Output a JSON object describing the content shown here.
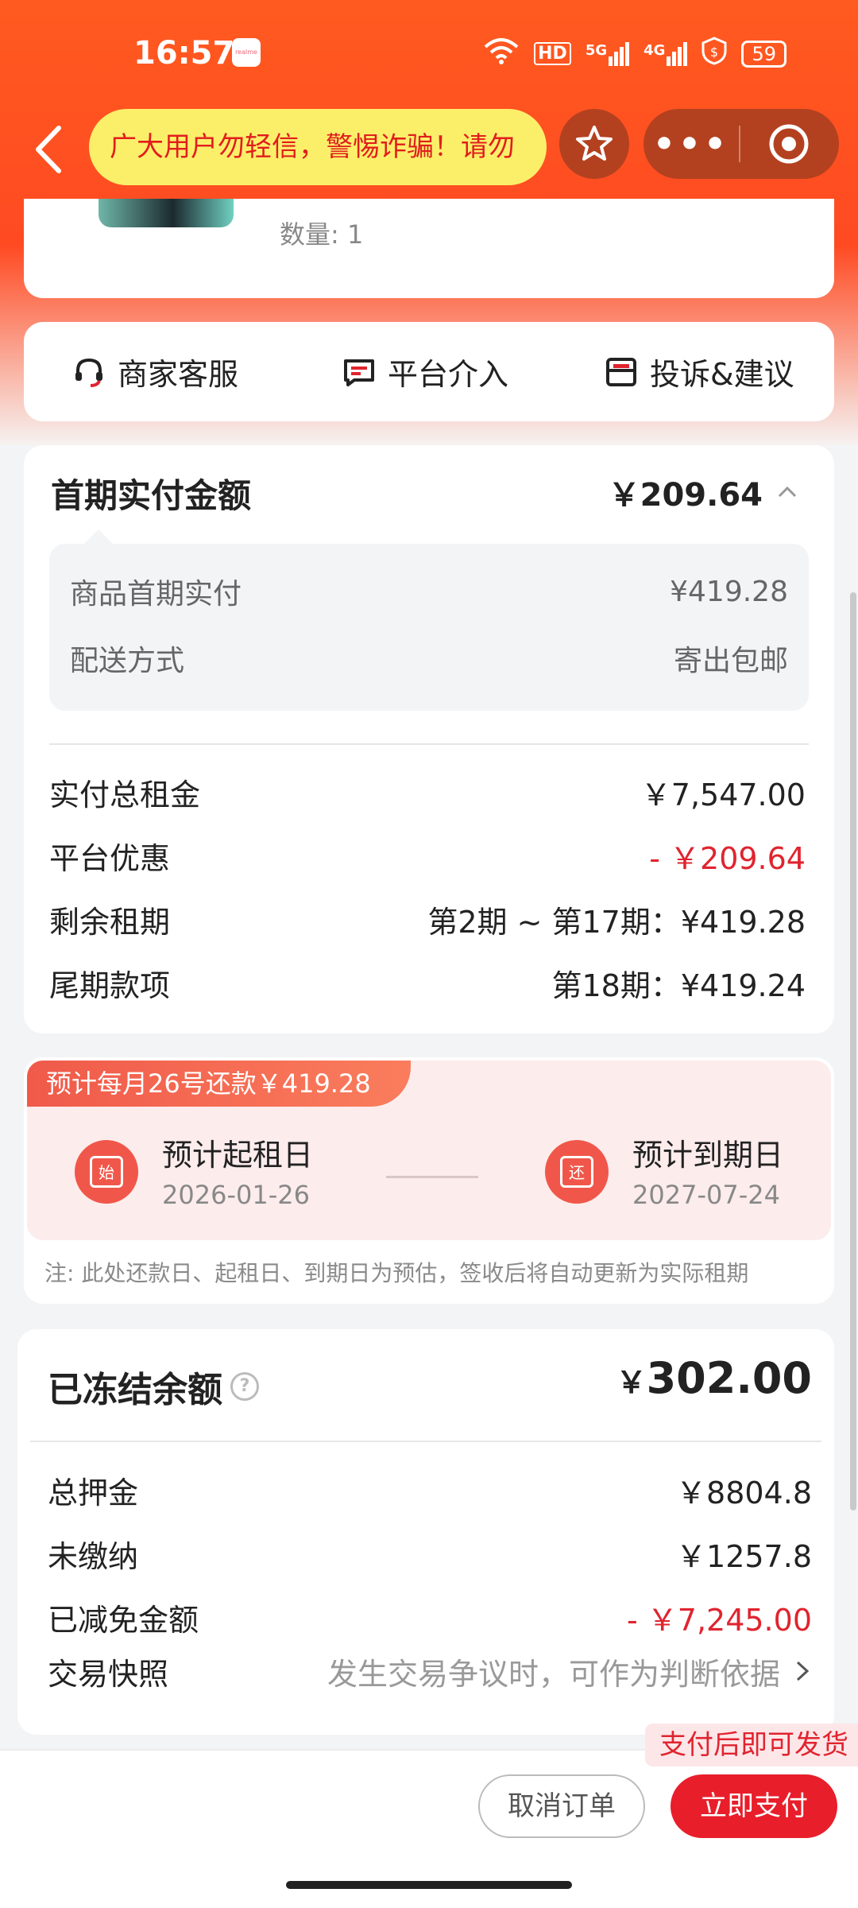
{
  "status_bar": {
    "time": "16:57",
    "app_icon_text": "realme",
    "network_hd": "HD",
    "network_5g": "5G",
    "network_4g": "4G",
    "battery": "59"
  },
  "nav": {
    "notice_text": "广大用户勿轻信，警惕诈骗！请勿",
    "more_label": "•••"
  },
  "product": {
    "quantity": "数量: 1"
  },
  "service": {
    "items": [
      {
        "label": "商家客服",
        "icon": "headset-icon"
      },
      {
        "label": "平台介入",
        "icon": "message-icon"
      },
      {
        "label": "投诉&建议",
        "icon": "mailbox-icon"
      }
    ]
  },
  "first_payment": {
    "title": "首期实付金额",
    "amount": "￥209.64",
    "details": [
      {
        "label": "商品首期实付",
        "value": "¥419.28"
      },
      {
        "label": "配送方式",
        "value": "寄出包邮"
      }
    ],
    "rows": [
      {
        "label": "实付总租金",
        "value": "￥7,547.00"
      },
      {
        "label": "平台优惠",
        "value": "- ￥209.64"
      },
      {
        "label": "剩余租期",
        "value": "第2期 ~ 第17期：¥419.28"
      },
      {
        "label": "尾期款项",
        "value": "第18期：¥419.24"
      }
    ]
  },
  "repayment": {
    "tag": "预计每月26号还款￥419.28",
    "start_icon_char": "始",
    "start_label": "预计起租日",
    "start_date": "2026-01-26",
    "end_icon_char": "还",
    "end_label": "预计到期日",
    "end_date": "2027-07-24",
    "note": "注: 此处还款日、起租日、到期日为预估，签收后将自动更新为实际租期"
  },
  "frozen": {
    "title": "已冻结余额",
    "help": "?",
    "currency": "￥",
    "amount": "302.00",
    "rows": [
      {
        "label": "总押金",
        "value": "￥8804.8"
      },
      {
        "label": "未缴纳",
        "value": "￥1257.8"
      },
      {
        "label": "已减免金额",
        "value": "- ￥7,245.00"
      }
    ],
    "snapshot_label": "交易快照",
    "snapshot_value": "发生交易争议时，可作为判断依据"
  },
  "bottom": {
    "ship_tip": "支付后即可发货",
    "cancel_label": "取消订单",
    "pay_label": "立即支付"
  },
  "colors": {
    "header_orange": "#ff5a1f",
    "accent_red": "#e81e2b",
    "notice_yellow": "#fbef6a"
  }
}
